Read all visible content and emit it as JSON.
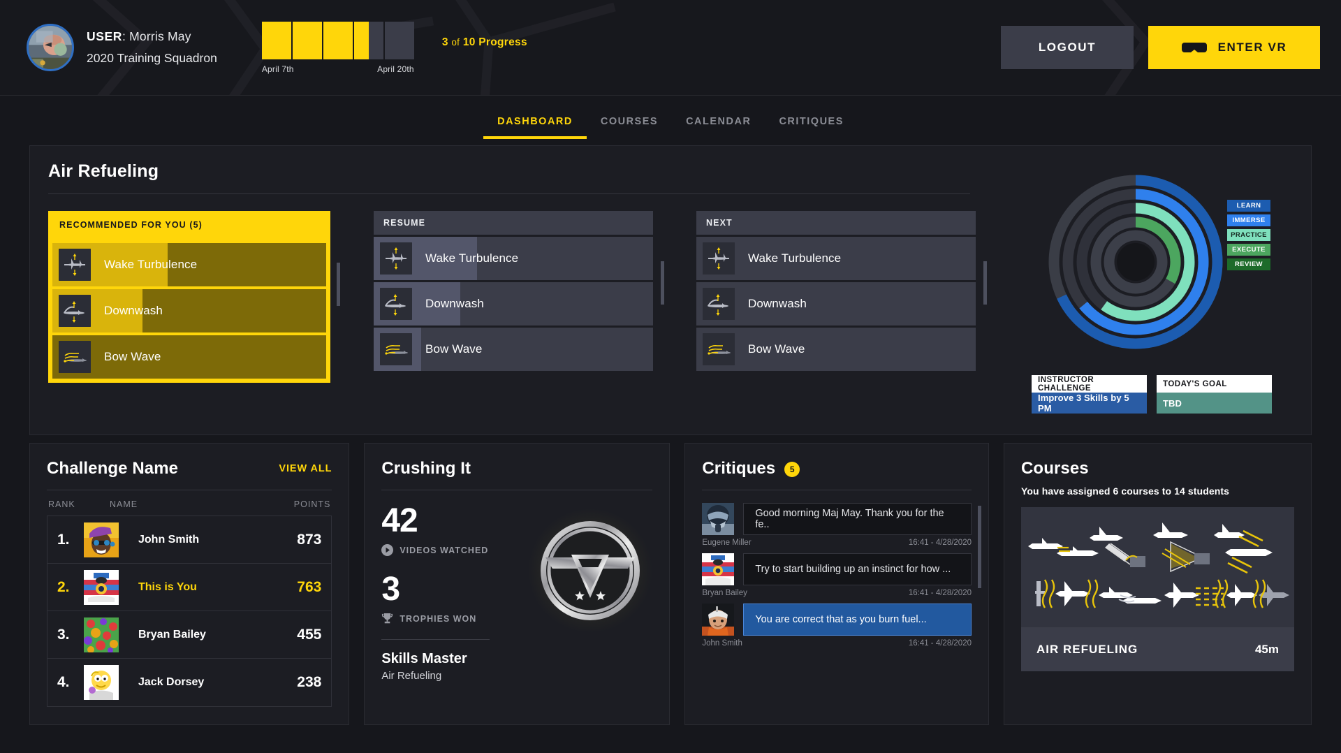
{
  "header": {
    "user_label": "USER",
    "user_name": "Morris May",
    "squadron": "2020 Training Squadron",
    "avatar_name": "pilot-avatar",
    "progress": {
      "segments": 5,
      "filled": 3.5,
      "start_date": "April 7th",
      "end_date": "April 20th",
      "count": "3",
      "of": "of",
      "total": "10",
      "suffix": "Progress"
    },
    "logout_label": "LOGOUT",
    "enter_vr_label": "ENTER VR"
  },
  "nav": {
    "items": [
      {
        "label": "DASHBOARD",
        "active": true
      },
      {
        "label": "COURSES",
        "active": false
      },
      {
        "label": "CALENDAR",
        "active": false
      },
      {
        "label": "CRITIQUES",
        "active": false
      }
    ]
  },
  "top_panel": {
    "title": "Air Refueling",
    "columns": [
      {
        "key": "recommended",
        "head": "RECOMMENDED FOR YOU (5)",
        "highlight": true,
        "items": [
          {
            "label": "Wake Turbulence",
            "progress": 42,
            "thumb": "wake-turbulence-thumb"
          },
          {
            "label": "Downwash",
            "progress": 33,
            "thumb": "downwash-thumb"
          },
          {
            "label": "Bow Wave",
            "progress": 0,
            "thumb": "bow-wave-thumb"
          }
        ]
      },
      {
        "key": "resume",
        "head": "RESUME",
        "highlight": false,
        "items": [
          {
            "label": "Wake Turbulence",
            "progress": 37,
            "thumb": "wake-turbulence-thumb"
          },
          {
            "label": "Downwash",
            "progress": 31,
            "thumb": "downwash-thumb"
          },
          {
            "label": "Bow Wave",
            "progress": 17,
            "thumb": "bow-wave-thumb"
          }
        ]
      },
      {
        "key": "next",
        "head": "NEXT",
        "highlight": false,
        "items": [
          {
            "label": "Wake Turbulence",
            "progress": 0,
            "thumb": "wake-turbulence-thumb"
          },
          {
            "label": "Downwash",
            "progress": 0,
            "thumb": "downwash-thumb"
          },
          {
            "label": "Bow Wave",
            "progress": 0,
            "thumb": "bow-wave-thumb"
          }
        ]
      }
    ],
    "radial": {
      "legend": [
        {
          "label": "LEARN",
          "color": "#1c5cb0"
        },
        {
          "label": "IMMERSE",
          "color": "#2f80ed"
        },
        {
          "label": "PRACTICE",
          "color": "#7fe0bd"
        },
        {
          "label": "EXECUTE",
          "color": "#4ca65f"
        },
        {
          "label": "REVIEW",
          "color": "#1d6b2a"
        }
      ],
      "rings": [
        {
          "name": "LEARN",
          "color": "#1c5cb0",
          "track": "#3a3d46",
          "percent": 68
        },
        {
          "name": "IMMERSE",
          "color": "#2f80ed",
          "track": "#34363f",
          "percent": 64
        },
        {
          "name": "PRACTICE",
          "color": "#7fe0bd",
          "track": "#2f313a",
          "percent": 60
        },
        {
          "name": "EXECUTE",
          "color": "#4ca65f",
          "track": "#3c3f49",
          "percent": 33
        },
        {
          "name": "REVIEW",
          "color": "#3c3f49",
          "track": "#3c3f49",
          "percent": 0
        }
      ]
    },
    "goals": [
      {
        "head": "INSTRUCTOR CHALLENGE",
        "body": "Improve 3 Skills by 5 PM",
        "color": "#2a5ca4"
      },
      {
        "head": "TODAY'S GOAL",
        "body": "TBD",
        "color": "#539387"
      }
    ]
  },
  "leaderboard": {
    "title": "Challenge Name",
    "view_all": "VIEW ALL",
    "columns": {
      "rank": "RANK",
      "name": "NAME",
      "points": "POINTS"
    },
    "rows": [
      {
        "rank": "1.",
        "name": "John Smith",
        "points": "873",
        "you": false,
        "avatar": "avatar-john-smith"
      },
      {
        "rank": "2.",
        "name": "This is You",
        "points": "763",
        "you": true,
        "avatar": "avatar-this-is-you"
      },
      {
        "rank": "3.",
        "name": "Bryan Bailey",
        "points": "455",
        "you": false,
        "avatar": "avatar-bryan-bailey"
      },
      {
        "rank": "4.",
        "name": "Jack Dorsey",
        "points": "238",
        "you": false,
        "avatar": "avatar-jack-dorsey"
      }
    ]
  },
  "crushing": {
    "title": "Crushing It",
    "videos_count": "42",
    "videos_label": "VIDEOS WATCHED",
    "trophies_count": "3",
    "trophies_label": "TROPHIES WON",
    "master_title": "Skills Master",
    "master_sub": "Air Refueling",
    "medal_name": "silver-skills-master-medal"
  },
  "critiques": {
    "title": "Critiques",
    "count": "5",
    "items": [
      {
        "text": "Good morning Maj May. Thank you for the fe..",
        "name": "Eugene Miller",
        "time": "16:41 - 4/28/2020",
        "selected": false,
        "avatar": "avatar-eugene-miller"
      },
      {
        "text": "Try to start building up an instinct for how ...",
        "name": "Bryan Bailey",
        "time": "16:41 - 4/28/2020",
        "selected": false,
        "avatar": "avatar-bryan-bailey"
      },
      {
        "text": "You are correct that as you burn fuel...",
        "name": "John Smith",
        "time": "16:41 - 4/28/2020",
        "selected": true,
        "avatar": "avatar-john-smith"
      }
    ]
  },
  "courses": {
    "title": "Courses",
    "subtitle": "You have assigned 6 courses to 14 students",
    "tile": {
      "name": "AIR REFUELING",
      "duration": "45m",
      "art": "air-refueling-montage"
    }
  }
}
